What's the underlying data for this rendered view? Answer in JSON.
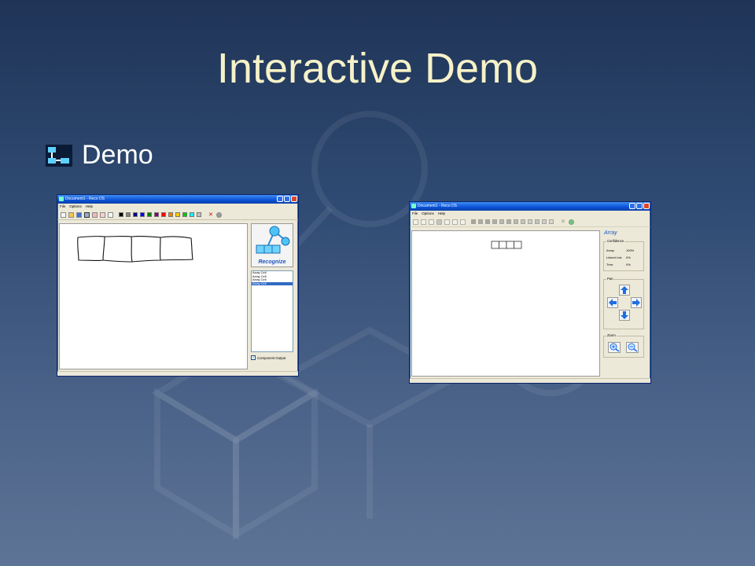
{
  "slide": {
    "title": "Interactive Demo",
    "bullet": "Demo"
  },
  "colors": {
    "title": "#f6f2c8",
    "background_top": "#1f3457",
    "background_bottom": "#5e7496",
    "selection": "#316ac5"
  },
  "window1": {
    "title": "Document1 - Reco DS",
    "menu": [
      "File",
      "Options",
      "Help"
    ],
    "recognize_label": "Recognize",
    "list_items": [
      "Array Cell",
      "Array Cell",
      "Array Cell",
      "Array Cell"
    ],
    "selected_item": 3,
    "checkbox_label": "Component Output",
    "checkbox_checked": true,
    "palette": [
      "#000000",
      "#808080",
      "#000080",
      "#0000ff",
      "#008000",
      "#800080",
      "#ff0000",
      "#ff8000",
      "#ffcc00",
      "#00cc00",
      "#00ffff",
      "#c0c0c0"
    ]
  },
  "window2": {
    "title": "Document1 - Reco DS",
    "menu": [
      "File",
      "Options",
      "Help"
    ],
    "result_label": "Array",
    "confidence_title": "Confidence",
    "confidence": [
      {
        "label": "Array:",
        "value": "100%"
      },
      {
        "label": "Linked List:",
        "value": "0%"
      },
      {
        "label": "Tree:",
        "value": "0%"
      }
    ],
    "pan_title": "Pan",
    "zoom_title": "Zoom"
  }
}
